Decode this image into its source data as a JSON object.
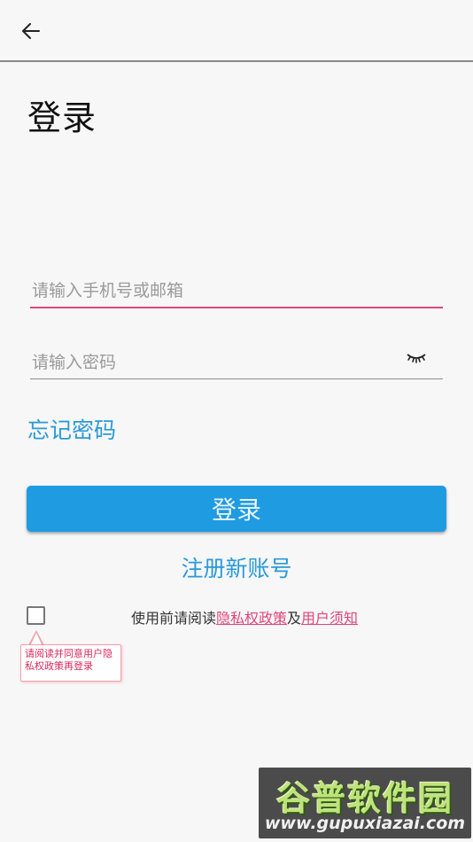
{
  "header": {
    "back_icon": "arrow-left-icon"
  },
  "page": {
    "title": "登录"
  },
  "form": {
    "phone_placeholder": "请输入手机号或邮箱",
    "password_placeholder": "请输入密码",
    "password_toggle_icon": "eye-closed-icon",
    "forgot_label": "忘记密码",
    "login_label": "登录",
    "register_label": "注册新账号"
  },
  "agreement": {
    "prefix": "使用前请阅读",
    "privacy_link": "隐私权政策",
    "joiner": "及",
    "terms_link": "用户须知",
    "tooltip": "请阅读并同意用户隐私权政策再登录"
  },
  "watermark": {
    "title": "谷普软件园",
    "url": "www.gupuxiazai.com"
  },
  "colors": {
    "accent_blue": "#1f9be2",
    "link_blue": "#2a9ad8",
    "focus_pink": "#e0457a"
  }
}
